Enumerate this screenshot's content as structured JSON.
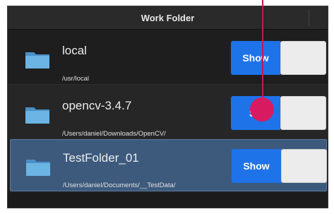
{
  "header": {
    "title": "Work Folder"
  },
  "folders": [
    {
      "name": "local",
      "path": "/usr/local",
      "toggle_label": "Show"
    },
    {
      "name": "opencv-3.4.7",
      "path": "/Users/daniel/Downloads/OpenCV/",
      "toggle_label": "Sh"
    },
    {
      "name": "TestFolder_01",
      "path": "/Users/daniel/Documents/__TestData/",
      "toggle_label": "Show"
    }
  ],
  "colors": {
    "accent": "#1e73e8",
    "selection": "#3d5a7d",
    "pointer": "#d81b60",
    "folder": "#5fa8dc"
  }
}
